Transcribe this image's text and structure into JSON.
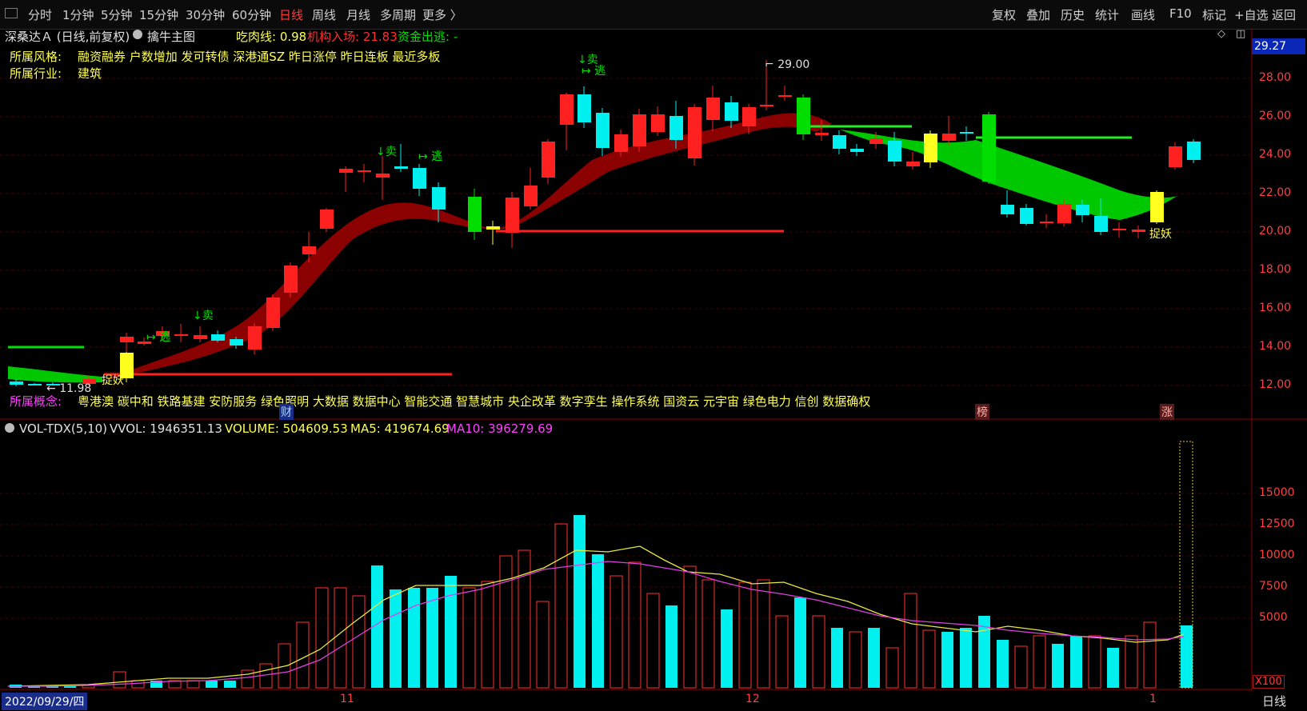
{
  "toolbar": {
    "left": [
      "分时",
      "1分钟",
      "5分钟",
      "15分钟",
      "30分钟",
      "60分钟",
      "日线",
      "周线",
      "月线",
      "多周期",
      "更多 〉"
    ],
    "active": "日线",
    "right": [
      "复权",
      "叠加",
      "历史",
      "统计",
      "画线",
      "F10",
      "标记",
      "+自选",
      "返回"
    ]
  },
  "stock": {
    "name": "深桑达Ａ (日线,前复权)",
    "indicator": "擒牛主图",
    "chirou_label": "吃肉线: 0.98",
    "jigou_label": "机构入场: 21.83",
    "zijin_label": "资金出逃: -",
    "style_label": "所属风格:",
    "style_value": "融资融券 户数增加 发可转债 深港通SZ 昨日涨停 昨日连板 最近多板",
    "industry_label": "所属行业:",
    "industry_value": "建筑",
    "concept_label": "所属概念:",
    "concept_value": "粤港澳 碳中和 铁路基建 安防服务 绿色照明 大数据 数据中心 智能交通 智慧城市 央企改革 数字孪生 操作系统 国资云 元宇宙 绿色电力 信创 数据确权"
  },
  "price_axis": {
    "current": "29.27",
    "ticks": [
      "28.00",
      "26.00",
      "24.00",
      "22.00",
      "20.00",
      "18.00",
      "16.00",
      "14.00",
      "12.00"
    ]
  },
  "annotations": {
    "high": "29.00",
    "low": "11.98",
    "sell": "↓卖",
    "escape": "逃",
    "catch": "捉妖",
    "cai": "财",
    "bang": "榜",
    "zhang": "涨"
  },
  "volume": {
    "title": "VOL-TDX(5,10)",
    "vvol": "VVOL: 1946351.13",
    "volume": "VOLUME: 504609.53",
    "ma5": "MA5: 419674.69",
    "ma10": "MA10: 396279.69",
    "ticks": [
      "15000",
      "12500",
      "10000",
      "7500",
      "5000"
    ],
    "unit": "X100"
  },
  "footer": {
    "date": "2022/09/29/四",
    "x_labels": [
      "11",
      "12",
      "1"
    ],
    "period": "日线"
  },
  "colors": {
    "up": "#ff2020",
    "down": "#00f0f0",
    "grid": "#5a0000",
    "accent": "#ff3b3b"
  }
}
